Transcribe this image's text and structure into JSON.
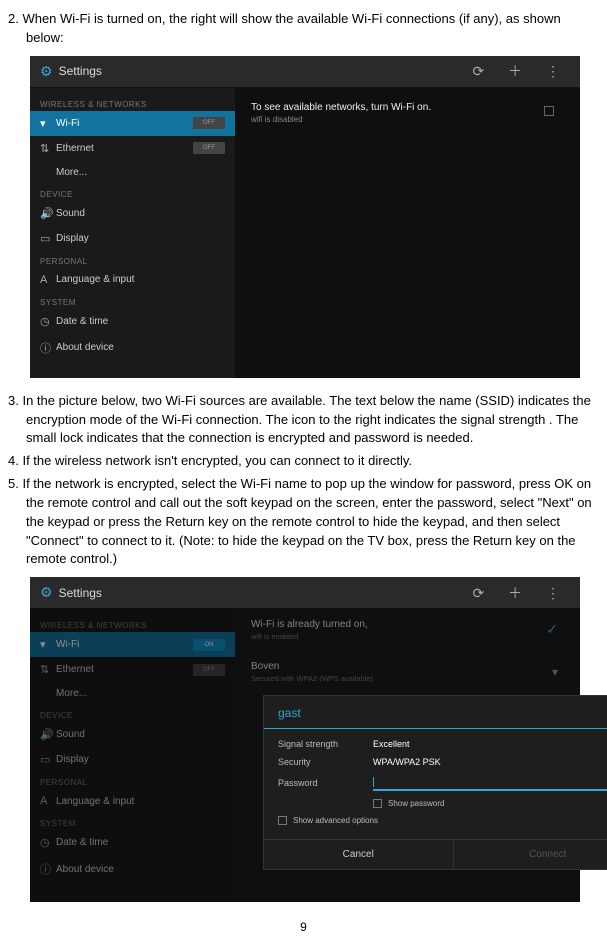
{
  "document": {
    "step2": "2. When Wi-Fi is turned on, the right will show the available Wi-Fi connections (if any), as shown below:",
    "step3": "3. In the picture below, two Wi-Fi sources are available. The text below the name (SSID) indicates the encryption mode of the Wi-Fi connection. The icon to the right indicates the signal strength . The small lock indicates that the connection is encrypted and password is needed.",
    "step4": "4. If the wireless network isn't encrypted, you can connect to it directly.",
    "step5": "5. If the network is encrypted, select the Wi-Fi name to pop up the window for password, press OK on the remote control and call out the soft keypad on the screen, enter the password, select \"Next\" on the keypad or press the Return key on the remote control to hide the keypad, and then select \"Connect\" to connect to it. (Note: to hide the keypad on the TV box, press the Return key on the remote control.)",
    "page_number": "9"
  },
  "ui_common": {
    "settings_title": "Settings",
    "cat_wireless": "WIRELESS & NETWORKS",
    "cat_device": "DEVICE",
    "cat_personal": "PERSONAL",
    "cat_system": "SYSTEM",
    "row_wifi": "Wi-Fi",
    "row_ethernet": "Ethernet",
    "row_more": "More...",
    "row_sound": "Sound",
    "row_display": "Display",
    "row_lang": "Language & input",
    "row_date": "Date & time",
    "row_about": "About device",
    "toggle_off": "OFF",
    "toggle_on": "ON",
    "header_icons": "⟳ ＋ ⋮"
  },
  "ui1": {
    "right_message": "To see available networks, turn Wi-Fi on.",
    "right_sub": "wifi is disabled"
  },
  "ui2": {
    "right_message": "Wi-Fi is already turned on,",
    "right_sub": "wifi is enabled",
    "network1_name": "Boven",
    "network1_sub": "Secured with WPA2 (WPS available)",
    "dialog": {
      "title": "gast",
      "signal_label": "Signal strength",
      "signal_value": "Excellent",
      "security_label": "Security",
      "security_value": "WPA/WPA2 PSK",
      "password_label": "Password",
      "show_password": "Show password",
      "show_advanced": "Show advanced options",
      "cancel": "Cancel",
      "connect": "Connect"
    }
  }
}
